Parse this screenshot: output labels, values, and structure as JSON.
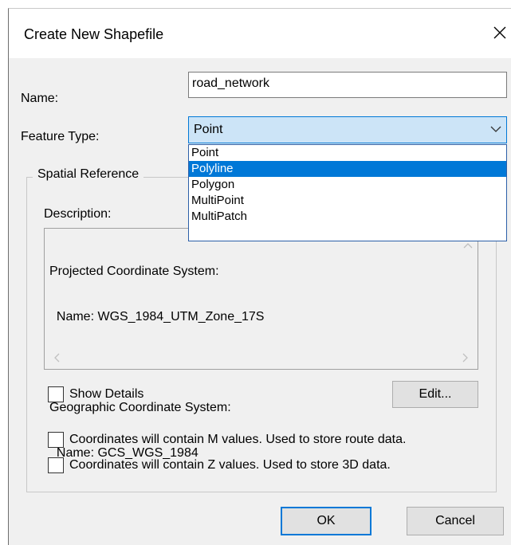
{
  "dialog": {
    "title": "Create New Shapefile",
    "close_glyph": "✕"
  },
  "name_field": {
    "label": "Name:",
    "value": "road_network"
  },
  "feature_type": {
    "label": "Feature Type:",
    "selected": "Point",
    "options": [
      "Point",
      "Polyline",
      "Polygon",
      "MultiPoint",
      "MultiPatch"
    ],
    "highlighted": "Polyline"
  },
  "spatial_reference": {
    "legend": "Spatial Reference",
    "description_label": "Description:",
    "description_lines": [
      "Projected Coordinate System:",
      "  Name: WGS_1984_UTM_Zone_17S",
      "",
      "Geographic Coordinate System:",
      "  Name: GCS_WGS_1984"
    ],
    "show_details_label": "Show Details",
    "show_details_checked": false,
    "edit_label": "Edit..."
  },
  "options": {
    "m_values_label": "Coordinates will contain M values. Used to store route data.",
    "m_values_checked": false,
    "z_values_label": "Coordinates will contain Z values. Used to store 3D data.",
    "z_values_checked": false
  },
  "buttons": {
    "ok_label": "OK",
    "cancel_label": "Cancel"
  },
  "colors": {
    "accent": "#0078d7",
    "combo_fill": "#cce4f7",
    "dialog_bg": "#f0f0f0"
  }
}
